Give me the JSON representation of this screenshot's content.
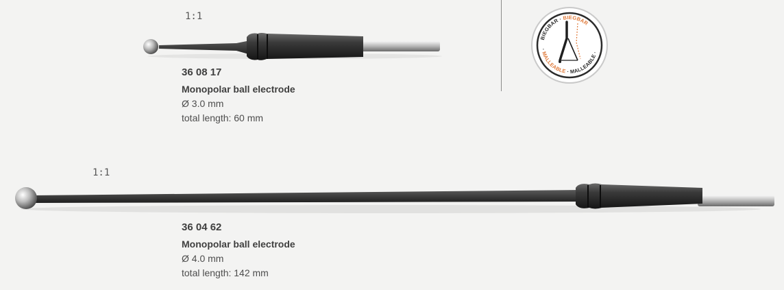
{
  "items": [
    {
      "scale": "1:1",
      "code": "36 08 17",
      "name": "Monopolar ball electrode",
      "diameter": "Ø 3.0 mm",
      "length": "total length: 60 mm"
    },
    {
      "scale": "1:1",
      "code": "36 04 62",
      "name": "Monopolar ball electrode",
      "diameter": "Ø 4.0 mm",
      "length": "total length: 142 mm"
    }
  ],
  "badge": {
    "top_text_de": "BIEGBAR",
    "top_text_de_orange": "BIEGBAR",
    "bottom_text_en": "MALLEABLE",
    "bottom_text_en_orange": "MALLEABLE",
    "accent_color": "#e07a3a",
    "text_color": "#2b2b2b"
  }
}
